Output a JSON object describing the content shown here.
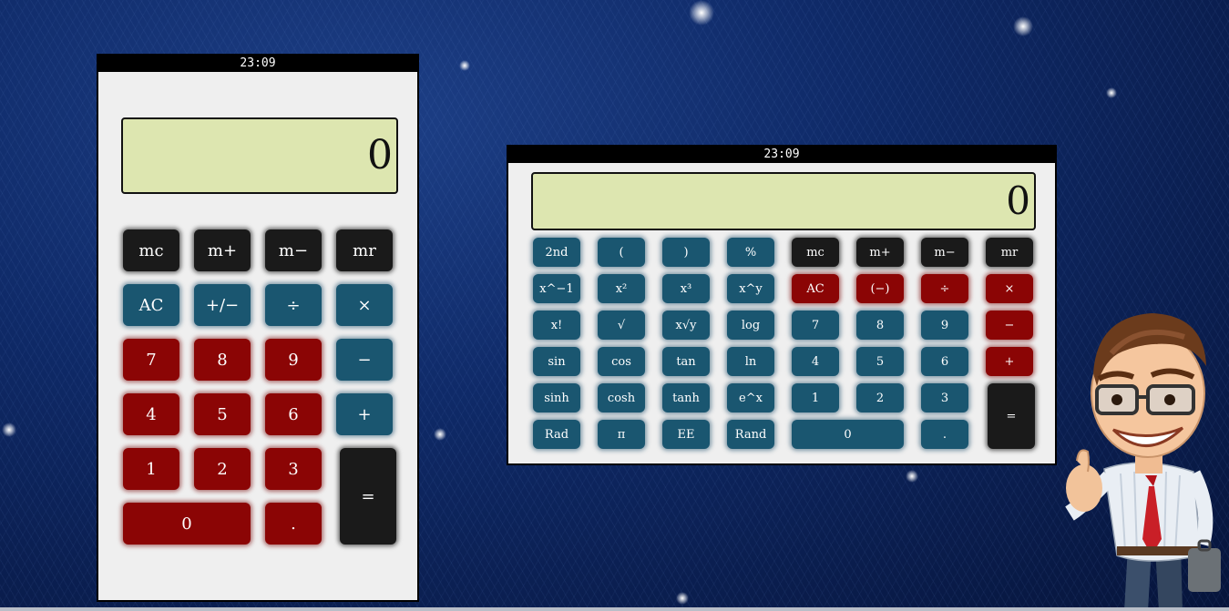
{
  "basic_calculator": {
    "time": "23:09",
    "display": "0",
    "buttons": {
      "mc": "mc",
      "mplus": "m+",
      "mminus": "m−",
      "mr": "mr",
      "ac": "AC",
      "plusminus": "+/−",
      "divide": "÷",
      "multiply": "×",
      "d7": "7",
      "d8": "8",
      "d9": "9",
      "minus": "−",
      "d4": "4",
      "d5": "5",
      "d6": "6",
      "plus": "+",
      "d1": "1",
      "d2": "2",
      "d3": "3",
      "equals": "=",
      "d0": "0",
      "dot": "."
    }
  },
  "scientific_calculator": {
    "time": "23:09",
    "display": "0",
    "buttons": {
      "second": "2nd",
      "lparen": "(",
      "rparen": ")",
      "percent": "%",
      "mc": "mc",
      "mplus": "m+",
      "mminus": "m−",
      "mr": "mr",
      "xinv": "x^−1",
      "xsq": "x²",
      "xcube": "x³",
      "xpowy": "x^y",
      "ac": "AC",
      "neg": "(−)",
      "divide": "÷",
      "multiply": "×",
      "fact": "x!",
      "sqrt": "√",
      "xrooty": "x√y",
      "log": "log",
      "d7": "7",
      "d8": "8",
      "d9": "9",
      "minus": "−",
      "sin": "sin",
      "cos": "cos",
      "tan": "tan",
      "ln": "ln",
      "d4": "4",
      "d5": "5",
      "d6": "6",
      "plus": "+",
      "sinh": "sinh",
      "cosh": "cosh",
      "tanh": "tanh",
      "epowx": "e^x",
      "d1": "1",
      "d2": "2",
      "d3": "3",
      "equals": "=",
      "rad": "Rad",
      "pi": "π",
      "ee": "EE",
      "rand": "Rand",
      "d0": "0",
      "dot": "."
    }
  },
  "colors": {
    "memory_button": "#1a1a1a",
    "digit_button": "#8b0505",
    "function_button": "#1a5670",
    "display_bg": "#dde6b0"
  }
}
